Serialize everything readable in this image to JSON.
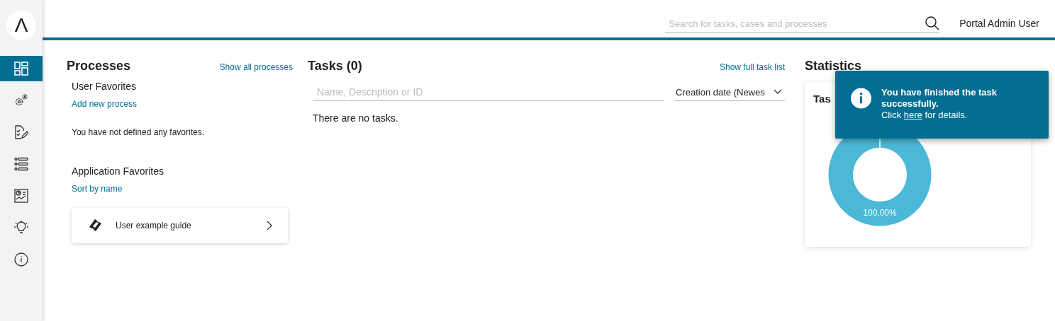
{
  "sidebar": {
    "logo": "Λ",
    "items": [
      {
        "kind": "dashboard",
        "selected": true
      },
      {
        "kind": "processes",
        "selected": false
      },
      {
        "kind": "tasks",
        "selected": false
      },
      {
        "kind": "cases",
        "selected": false
      },
      {
        "kind": "statistics",
        "selected": false
      },
      {
        "kind": "ideas",
        "selected": false
      },
      {
        "kind": "info",
        "selected": false
      }
    ]
  },
  "header": {
    "search": {
      "placeholder": "Search for tasks, cases and processes"
    },
    "user": "Portal Admin User"
  },
  "processes": {
    "title": "Processes",
    "link": "Show all processes",
    "user_favorites": {
      "title": "User Favorites",
      "link": "Add new process",
      "empty": "You have not defined any favorites."
    },
    "application_favorites": {
      "title": "Application Favorites",
      "link": "Sort by name",
      "items": [
        {
          "label": "User example guide"
        }
      ]
    }
  },
  "tasks": {
    "title": "Tasks (0)",
    "link": "Show full task list",
    "filter": {
      "placeholder": "Name, Description or ID"
    },
    "sort": "Creation date (Newes",
    "empty": "There are no tasks."
  },
  "statistics": {
    "title": "Statistics",
    "card": {
      "title": "Tas",
      "chart_label": "100.00%"
    }
  },
  "toast": {
    "title": "You have finished the task successfully.",
    "text_before": "Click",
    "link": "here",
    "text_after": "for details."
  }
}
